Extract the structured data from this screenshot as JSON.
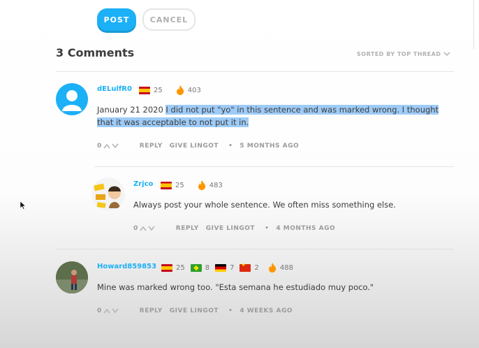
{
  "compose": {
    "post_label": "POST",
    "cancel_label": "CANCEL"
  },
  "header": {
    "title": "3 Comments",
    "sort_label": "SORTED BY TOP THREAD"
  },
  "comments": [
    {
      "username": "dELulfR0",
      "flags": [
        {
          "icon": "spain-flag-icon",
          "level": "25"
        }
      ],
      "streak": "403",
      "text_plain": "January 21 2020 ",
      "text_highlighted": "I did not put \"yo\" in this sentence and was marked wrong. I thought that it was acceptable to not put it in.",
      "votes": "0",
      "reply_label": "REPLY",
      "lingot_label": "GIVE LINGOT",
      "time": "5 MONTHS AGO"
    },
    {
      "username": "Zrjco",
      "flags": [
        {
          "icon": "spain-flag-icon",
          "level": "25"
        }
      ],
      "streak": "483",
      "text_plain": "Always post your whole sentence. We often miss something else.",
      "votes": "0",
      "reply_label": "REPLY",
      "lingot_label": "GIVE LINGOT",
      "time": "4 MONTHS AGO"
    },
    {
      "username": "Howard859853",
      "flags": [
        {
          "icon": "spain-flag-icon",
          "level": "25"
        },
        {
          "icon": "brazil-flag-icon",
          "level": "8"
        },
        {
          "icon": "germany-flag-icon",
          "level": "7"
        },
        {
          "icon": "china-flag-icon",
          "level": "2"
        }
      ],
      "streak": "488",
      "text_plain": "Mine was marked wrong too. \"Esta semana he estudiado muy poco.\"",
      "votes": "0",
      "reply_label": "REPLY",
      "lingot_label": "GIVE LINGOT",
      "time": "4 WEEKS AGO"
    }
  ],
  "colors": {
    "accent": "#1cb0f6",
    "highlight": "#9ecbf7",
    "streak": "#ff9600"
  }
}
